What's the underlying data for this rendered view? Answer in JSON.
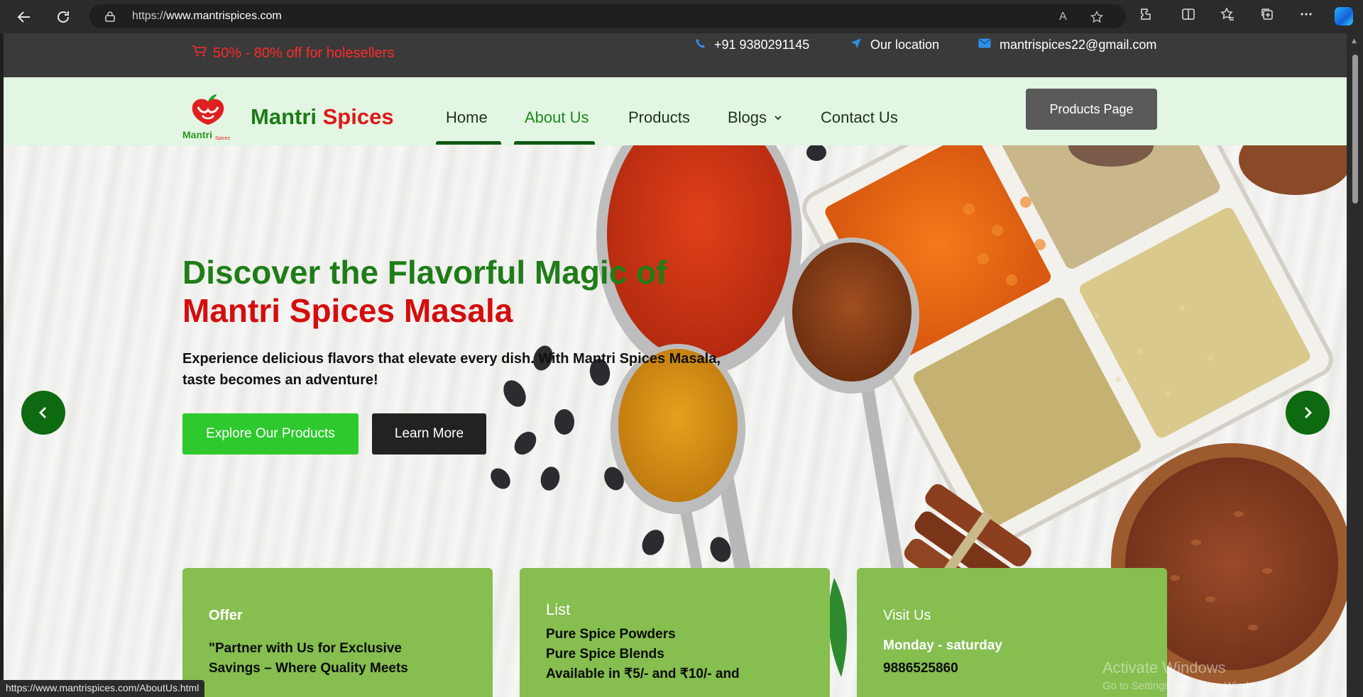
{
  "browser": {
    "url_prefix": "https://",
    "url_domain": "www.mantrispices.com",
    "read_aloud_icon": "A",
    "icons": [
      "back-icon",
      "refresh-icon",
      "lock-icon",
      "read-aloud-icon",
      "favorite-icon",
      "extensions-icon",
      "split-screen-icon",
      "favorites-icon",
      "collections-icon",
      "more-icon",
      "copilot-icon"
    ]
  },
  "topbar": {
    "offer": "50% - 80% off for holesellers",
    "phone": "+91 9380291145",
    "location": "Our location",
    "email": "mantrispices22@gmail.com"
  },
  "nav": {
    "brand_first": "Mantri",
    "brand_second": "Spices",
    "logo_text": "Mantri",
    "logo_sub": "Spices",
    "items": [
      {
        "label": "Home"
      },
      {
        "label": "About Us"
      },
      {
        "label": "Products"
      },
      {
        "label": "Blogs"
      },
      {
        "label": "Contact Us"
      }
    ],
    "cta": "Products Page"
  },
  "hero": {
    "title_line1": "Discover the Flavorful Magic of",
    "title_line2": "Mantri Spices Masala",
    "description": "Experience delicious flavors that elevate every dish. With Mantri Spices Masala, taste becomes an adventure!",
    "primary_button": "Explore Our Products",
    "secondary_button": "Learn More"
  },
  "cards": [
    {
      "title": "Offer",
      "lines": [
        "\"Partner with Us for Exclusive",
        "Savings – Where Quality Meets"
      ]
    },
    {
      "title": "List",
      "lines": [
        "Pure Spice Powders",
        "Pure Spice Blends",
        "Available in ₹5/- and ₹10/- and"
      ]
    },
    {
      "title": "Visit Us",
      "lines": [
        "Monday - saturday",
        "9886525860"
      ]
    }
  ],
  "watermark": {
    "line1": "Activate Windows",
    "line2": "Go to Settings to activate Windows."
  },
  "status_bar": {
    "link": "https://www.mantrispices.com/AboutUs.html"
  },
  "colors": {
    "brand_green": "#1f7d18",
    "brand_red": "#d40d0d",
    "card_green": "#86be50",
    "nav_bg": "#e3f5e3",
    "topbar_bg": "#3a3a3a"
  }
}
